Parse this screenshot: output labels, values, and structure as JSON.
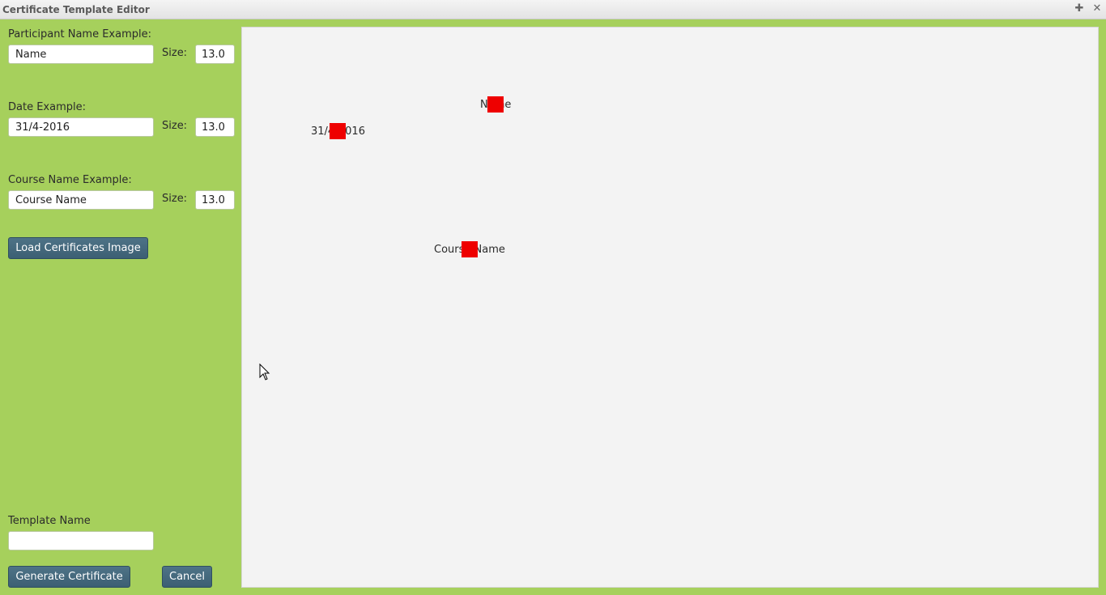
{
  "window": {
    "title": "Certificate Template Editor",
    "maximize_icon": "plus-icon",
    "close_icon": "close-icon"
  },
  "participant": {
    "label": "Participant Name Example:",
    "value": "Name",
    "size_label": "Size:",
    "size_value": "13.0"
  },
  "date": {
    "label": "Date Example:",
    "value": "31/4-2016",
    "size_label": "Size:",
    "size_value": "13.0"
  },
  "course": {
    "label": "Course Name Example:",
    "value": "Course Name",
    "size_label": "Size:",
    "size_value": "13.0"
  },
  "load_button": "Load Certificates Image",
  "template": {
    "label": "Template Name",
    "value": ""
  },
  "actions": {
    "generate": "Generate Certificate",
    "cancel": "Cancel"
  },
  "preview": {
    "name_text": "Name",
    "date_text": "31/4-2016",
    "course_text": "Course Name",
    "marker_color": "#ee0000"
  },
  "colors": {
    "panel_background": "#a6d05c",
    "button_background": "#45687c",
    "canvas_background": "#f3f3f3"
  }
}
